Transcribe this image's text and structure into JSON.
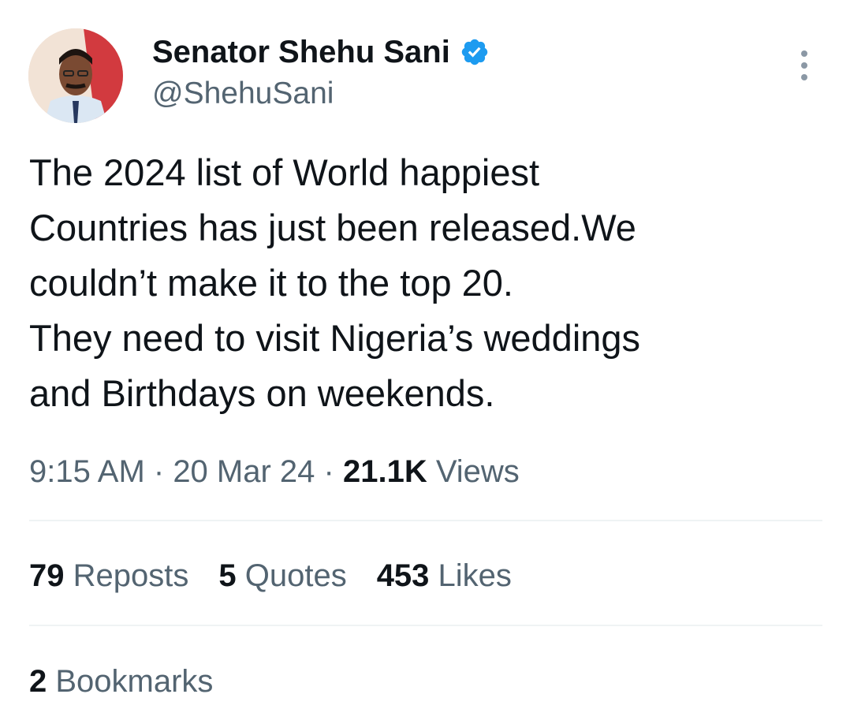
{
  "author": {
    "name": "Senator Shehu Sani",
    "handle": "@ShehuSani",
    "verified_color": "#1d9bf0"
  },
  "tweet": {
    "lines": [
      "The 2024 list of World happiest",
      "Countries has just been released.We",
      "couldn’t make it to the top 20.",
      "They need to visit Nigeria’s weddings",
      "and Birthdays on weekends."
    ]
  },
  "meta": {
    "time": "9:15 AM",
    "sep1": " · ",
    "date": "20 Mar 24",
    "sep2": " · ",
    "views_count": "21.1K",
    "views_label": " Views"
  },
  "stats": {
    "reposts_count": "79",
    "reposts_label": " Reposts",
    "quotes_count": "5",
    "quotes_label": " Quotes",
    "likes_count": "453",
    "likes_label": " Likes",
    "bookmarks_count": "2",
    "bookmarks_label": " Bookmarks"
  },
  "icons": {
    "avatar": "profile-photo",
    "verified": "verified-badge-icon",
    "more": "more-options-icon"
  },
  "colors": {
    "text_primary": "#0f1419",
    "text_secondary": "#536471",
    "divider": "#eff3f4"
  }
}
